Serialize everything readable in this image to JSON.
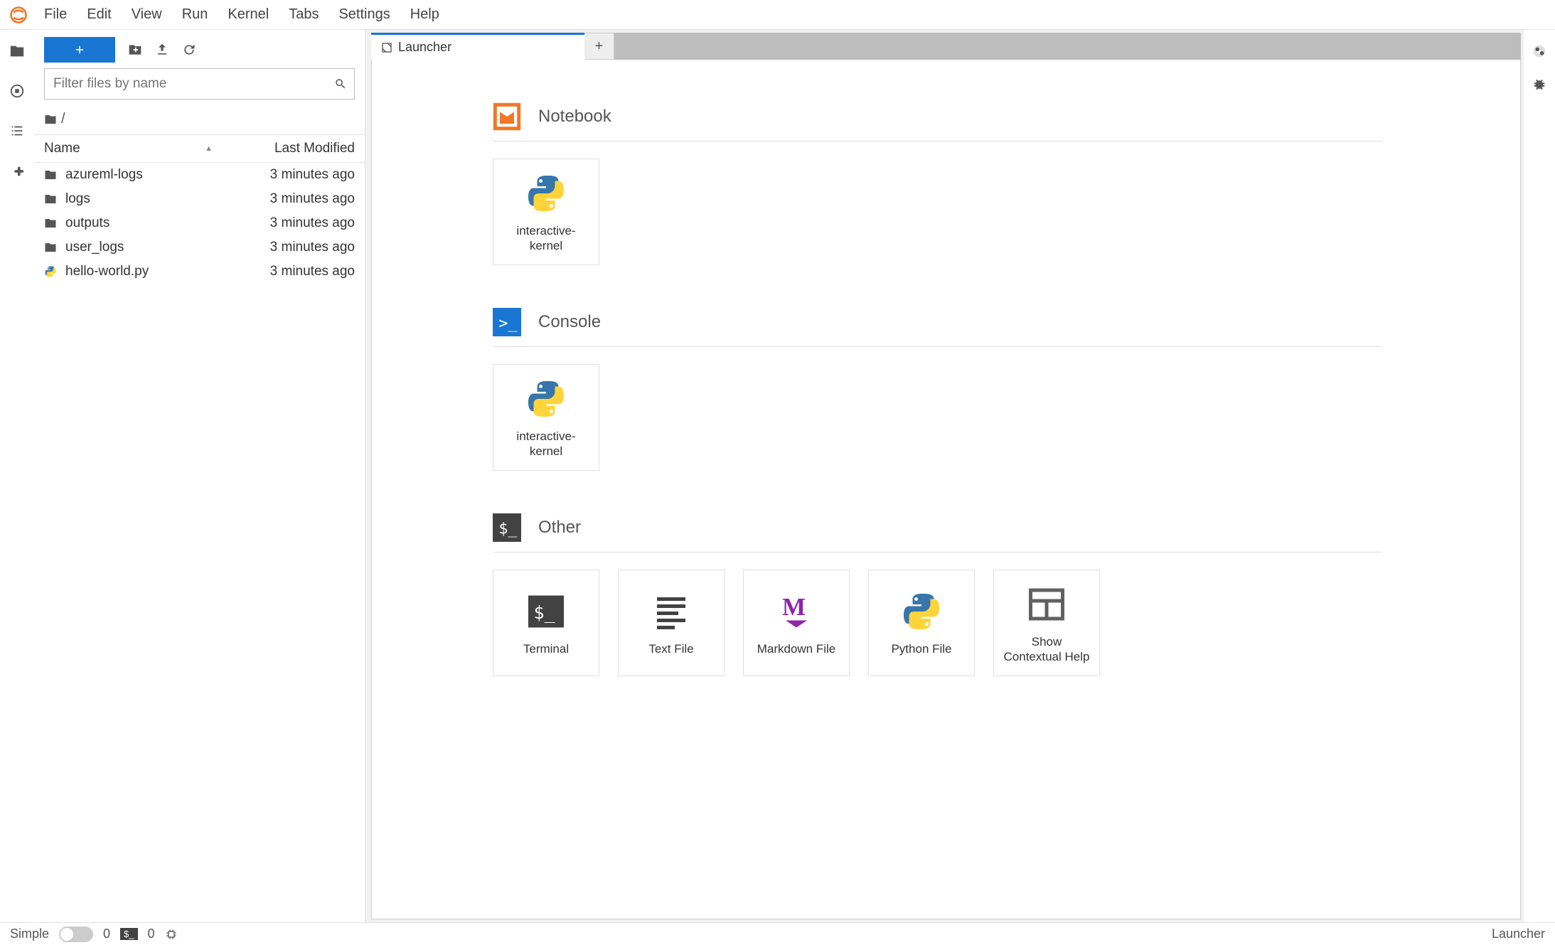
{
  "menu": [
    "File",
    "Edit",
    "View",
    "Run",
    "Kernel",
    "Tabs",
    "Settings",
    "Help"
  ],
  "filebrowser": {
    "filter_placeholder": "Filter files by name",
    "breadcrumb": "/",
    "headers": {
      "name": "Name",
      "modified": "Last Modified"
    },
    "rows": [
      {
        "icon": "folder",
        "name": "azureml-logs",
        "modified": "3 minutes ago"
      },
      {
        "icon": "folder",
        "name": "logs",
        "modified": "3 minutes ago"
      },
      {
        "icon": "folder",
        "name": "outputs",
        "modified": "3 minutes ago"
      },
      {
        "icon": "folder",
        "name": "user_logs",
        "modified": "3 minutes ago"
      },
      {
        "icon": "python",
        "name": "hello-world.py",
        "modified": "3 minutes ago"
      }
    ]
  },
  "tab": {
    "title": "Launcher"
  },
  "launcher": {
    "sections": [
      {
        "kind": "notebook",
        "title": "Notebook",
        "cards": [
          {
            "icon": "python-logo",
            "label": "interactive-kernel"
          }
        ]
      },
      {
        "kind": "console",
        "title": "Console",
        "cards": [
          {
            "icon": "python-logo",
            "label": "interactive-kernel"
          }
        ]
      },
      {
        "kind": "other",
        "title": "Other",
        "cards": [
          {
            "icon": "terminal-dark",
            "label": "Terminal"
          },
          {
            "icon": "text-file",
            "label": "Text File"
          },
          {
            "icon": "markdown",
            "label": "Markdown File"
          },
          {
            "icon": "python-logo",
            "label": "Python File"
          },
          {
            "icon": "context-help",
            "label": "Show Contextual Help"
          }
        ]
      }
    ]
  },
  "statusbar": {
    "simple": "Simple",
    "terminals": "0",
    "kernels_badge": "$_",
    "kernels_count": "0",
    "right": "Launcher"
  }
}
